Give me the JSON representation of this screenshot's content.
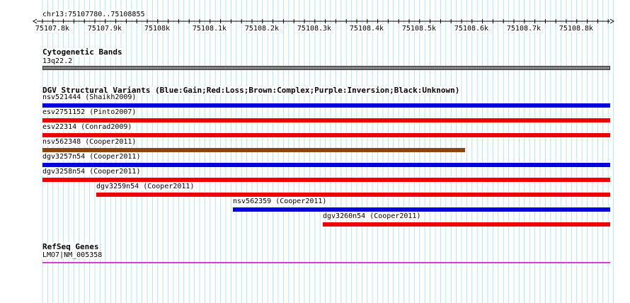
{
  "ruler": {
    "title": "chr13:75107780..75108855",
    "ticks": [
      "75107.8k",
      "75107.9k",
      "75108k",
      "75108.1k",
      "75108.2k",
      "75108.3k",
      "75108.4k",
      "75108.5k",
      "75108.6k",
      "75108.7k",
      "75108.8k"
    ]
  },
  "cytoband": {
    "title": "Cytogenetic Bands",
    "band": "13q22.2"
  },
  "dgv": {
    "title": "DGV Structural Variants (Blue:Gain;Red:Loss;Brown:Complex;Purple:Inversion;Black:Unknown)",
    "variants": [
      {
        "label": "nsv521444 (Shaikh2009)",
        "color": "#0000dd"
      },
      {
        "label": "esv2751152 (Pinto2007)",
        "color": "#ee0000"
      },
      {
        "label": "esv22314 (Conrad2009)",
        "color": "#ee0000"
      },
      {
        "label": "nsv562348 (Cooper2011)",
        "color": "#8b4513"
      },
      {
        "label": "dgv3257n54 (Cooper2011)",
        "color": "#0000dd"
      },
      {
        "label": "dgv3258n54 (Cooper2011)",
        "color": "#ee0000"
      },
      {
        "label": "dgv3259n54 (Cooper2011)",
        "color": "#ee0000"
      },
      {
        "label": "nsv562359 (Cooper2011)",
        "color": "#0000dd"
      },
      {
        "label": "dgv3260n54 (Cooper2011)",
        "color": "#ee0000"
      }
    ]
  },
  "refseq": {
    "title": "RefSeq Genes",
    "gene": "LMO7|NM_005358",
    "color": "#cc44cc"
  }
}
